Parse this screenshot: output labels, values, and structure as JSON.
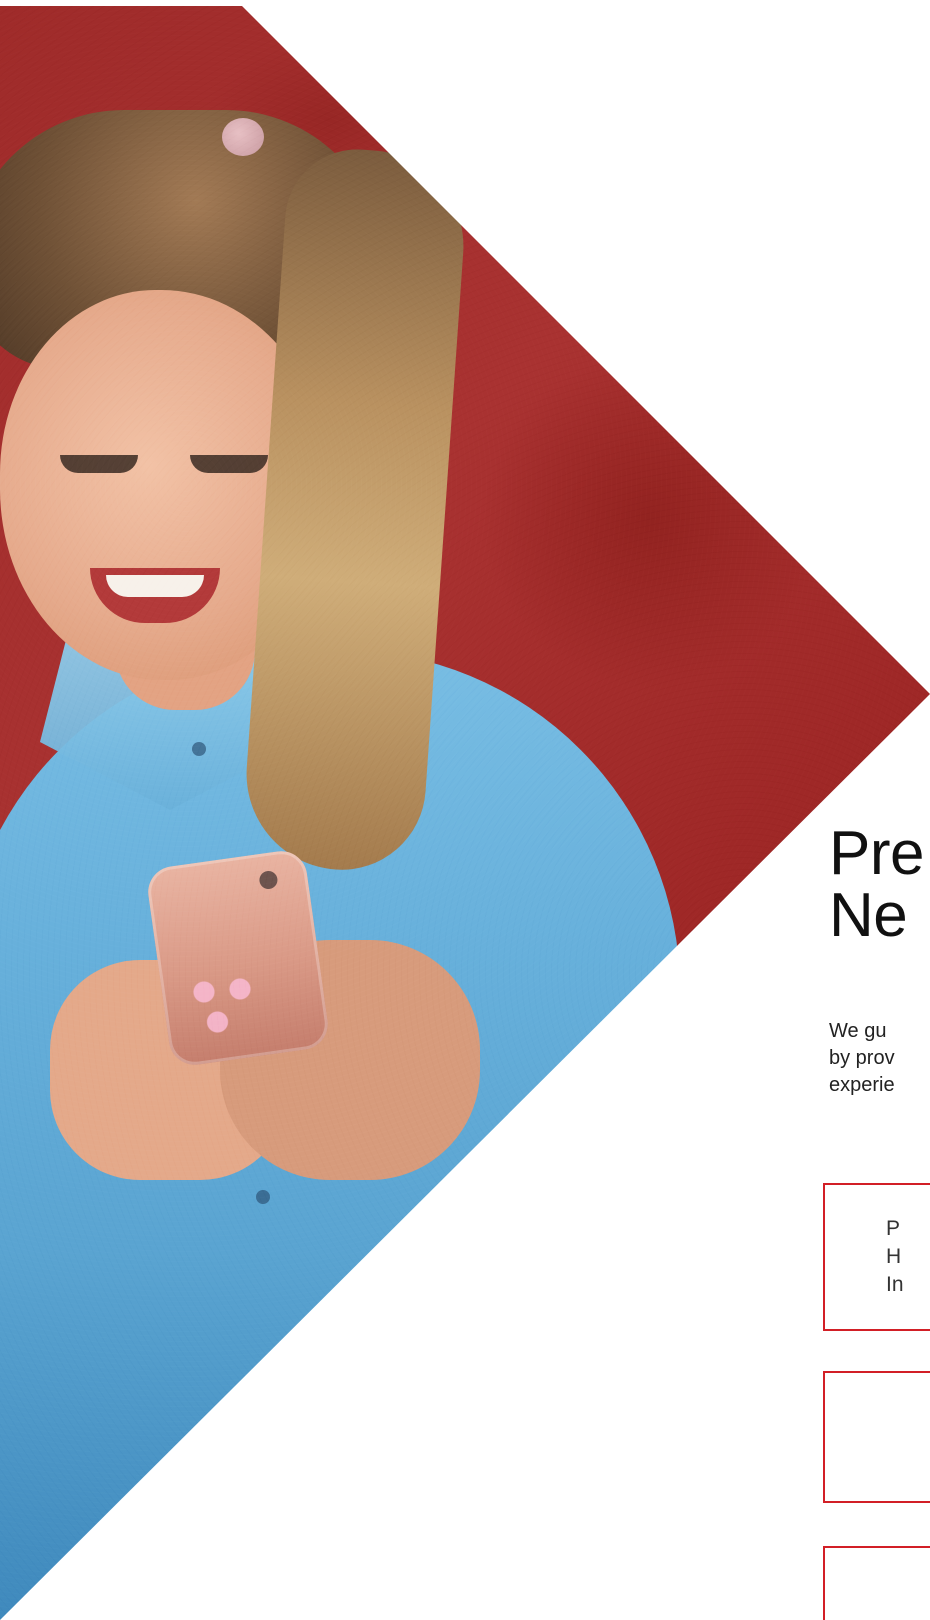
{
  "hero": {
    "image_alt": "Woman smiling while using a smartphone in front of a red wall",
    "colors": {
      "background_red": "#a32d2c",
      "shirt_blue": "#67b0db",
      "accent_red": "#d21f26"
    }
  },
  "headline": {
    "line1": "Pre",
    "line2": "Ne"
  },
  "body": {
    "line1": "We gu",
    "line2": "by prov",
    "line3": "experie"
  },
  "cards": [
    {
      "line1": "P",
      "line2": "H",
      "line3": "In"
    },
    {
      "line1": "",
      "line2": "",
      "line3": ""
    },
    {
      "line1": "",
      "line2": "",
      "line3": ""
    }
  ]
}
